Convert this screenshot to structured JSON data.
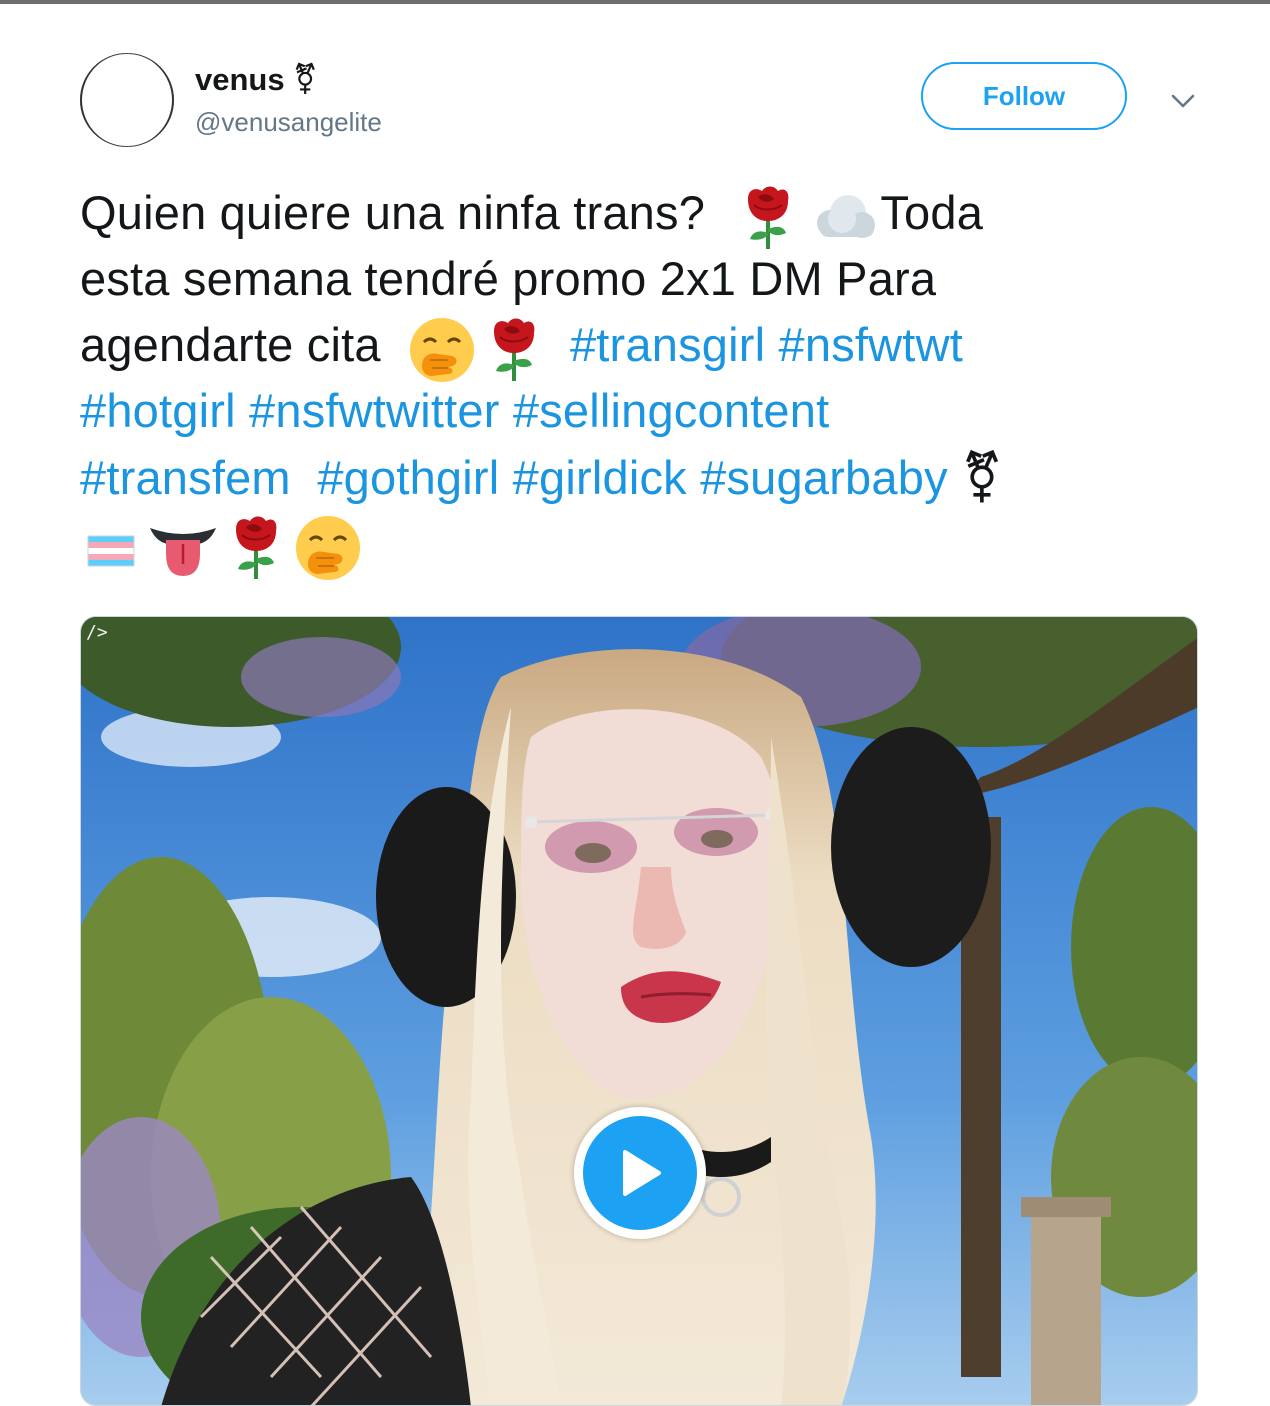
{
  "user": {
    "display_name": "venus",
    "name_symbol": "⚧",
    "handle": "@venusangelite"
  },
  "actions": {
    "follow_label": "Follow",
    "menu_icon": "chevron-down-icon"
  },
  "tweet": {
    "line1_text": "Quien quiere una ninfa trans? ",
    "line1_after_emoji": "Toda",
    "line2_text": "esta semana tendré promo 2x1 DM Para",
    "line3_text": "agendarte cita ",
    "hashtags": {
      "transgirl": "#transgirl",
      "nsfwtwt": "#nsfwtwt",
      "hotgirl": "#hotgirl",
      "nsfwtwitter": "#nsfwtwitter",
      "sellingcontent": "#sellingcontent",
      "transfem": "#transfem",
      "gothgirl": "#gothgirl",
      "girldick": "#girldick",
      "sugarbaby": "#sugarbaby"
    },
    "trans_symbol": "⚧",
    "emojis": [
      "rose",
      "cloud",
      "hand-over-mouth",
      "rose",
      "trans-flag",
      "tongue",
      "rose",
      "hand-over-mouth"
    ]
  },
  "media": {
    "type": "video",
    "corner_text": "/>",
    "play_icon": "play-icon"
  },
  "colors": {
    "accent": "#1da1f2",
    "hashtag": "#1b95e0",
    "text": "#14171a",
    "secondary": "#657786"
  }
}
